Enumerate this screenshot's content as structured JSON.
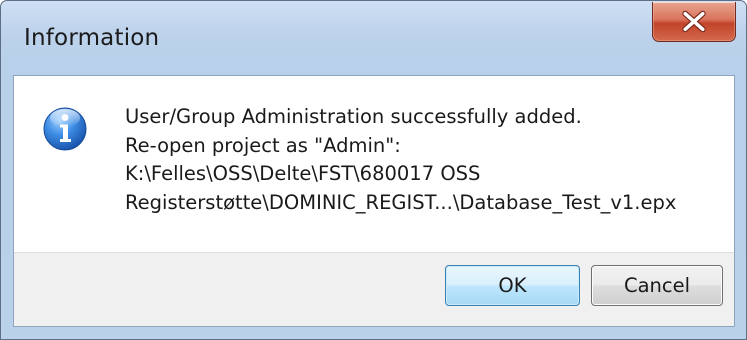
{
  "window": {
    "title": "Information",
    "close_glyph": "X"
  },
  "message": {
    "icon": "info-icon",
    "lines": [
      "User/Group Administration successfully added.",
      "Re-open project as \"Admin\":",
      "K:\\Felles\\OSS\\Delte\\FST\\680017 OSS",
      "Registerstøtte\\DOMINIC_REGIST...\\Database_Test_v1.epx"
    ]
  },
  "buttons": {
    "ok_label": "OK",
    "cancel_label": "Cancel"
  },
  "colors": {
    "title_bar": "#bfd4ec",
    "close_button": "#c94a33",
    "ok_border": "#3c7fb1",
    "info_icon": "#2f6fc9"
  }
}
